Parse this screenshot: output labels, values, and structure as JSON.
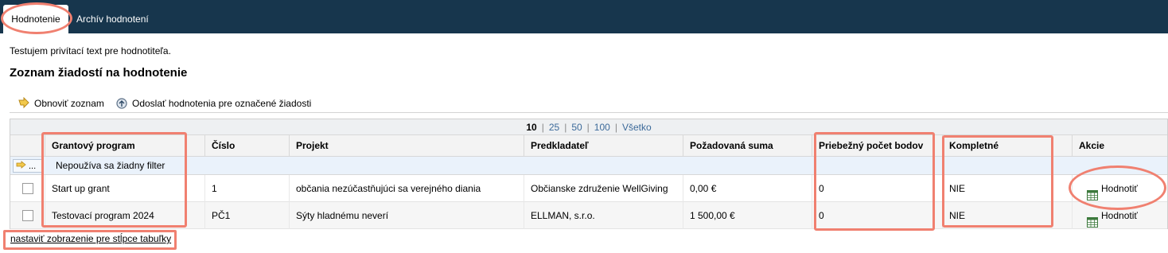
{
  "tabs": [
    {
      "label": "Hodnotenie",
      "active": true
    },
    {
      "label": "Archív hodnotení",
      "active": false
    }
  ],
  "intro_text": "Testujem privítací text pre hodnotiteľa.",
  "page_title": "Zoznam žiadostí na hodnotenie",
  "toolbar": {
    "refresh_label": "Obnoviť zoznam",
    "send_label": "Odoslať hodnotenia pre označené žiadosti"
  },
  "pager": {
    "options": [
      "10",
      "25",
      "50",
      "100",
      "Všetko"
    ],
    "selected": "10"
  },
  "columns": {
    "program": "Grantový program",
    "number": "Číslo",
    "project": "Projekt",
    "applicant": "Predkladateľ",
    "amount": "Požadovaná suma",
    "score": "Priebežný počet bodov",
    "complete": "Kompletné",
    "actions": "Akcie"
  },
  "filter": {
    "button_label": "...",
    "text": "Nepoužíva sa žiadny filter"
  },
  "rows": [
    {
      "program": "Start up grant",
      "number": "1",
      "project": "občania nezúčastňujúci sa verejného diania",
      "applicant": "Občianske združenie WellGiving",
      "amount": "0,00 €",
      "score": "0",
      "complete": "NIE",
      "action": "Hodnotiť"
    },
    {
      "program": "Testovací program 2024",
      "number": "PČ1",
      "project": "Sýty hladnému neverí",
      "applicant": "ELLMAN, s.r.o.",
      "amount": "1 500,00 €",
      "score": "0",
      "complete": "NIE",
      "action": "Hodnotiť"
    }
  ],
  "settings_link": "nastaviť zobrazenie pre stĺpce tabuľky",
  "colors": {
    "topbar": "#17364d",
    "annotation": "#f08070",
    "link": "#3c6a9a"
  },
  "icons": [
    "refresh-icon",
    "send-icon",
    "filter-icon",
    "grid-icon"
  ]
}
